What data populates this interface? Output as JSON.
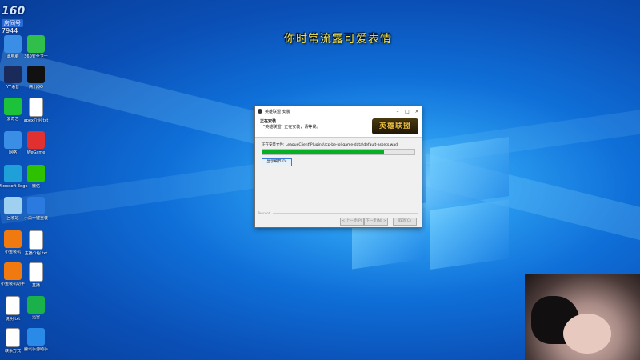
{
  "overlay": {
    "caption": "你时常流露可爱表情"
  },
  "watermark": {
    "logo": "160",
    "tag": "房间号",
    "room": "7944"
  },
  "desktop_icons": [
    {
      "label": "此电脑",
      "icon": "computer-icon",
      "color": "#3a8ee6"
    },
    {
      "label": "360安全卫士",
      "icon": "shield-icon",
      "color": "#2fbf4a"
    },
    {
      "label": "YY语音",
      "icon": "yy-icon",
      "color": "#1a2a5a"
    },
    {
      "label": "腾讯QQ",
      "icon": "qq-penguin-icon",
      "color": "#111111"
    },
    {
      "label": "爱奇艺",
      "icon": "iqiyi-icon",
      "color": "#1cc23a"
    },
    {
      "label": "apex介绍.txt",
      "icon": "file-icon",
      "color": "#ffffff"
    },
    {
      "label": "网络",
      "icon": "network-icon",
      "color": "#3a8ee6"
    },
    {
      "label": "WeGame",
      "icon": "wegame-icon",
      "color": "#e03030"
    },
    {
      "label": "Microsoft Edge",
      "icon": "edge-icon",
      "color": "#1fa0d8"
    },
    {
      "label": "微信",
      "icon": "wechat-icon",
      "color": "#2dc100"
    },
    {
      "label": "回收站",
      "icon": "recycle-bin-icon",
      "color": "#9fd0f0"
    },
    {
      "label": "小白一键重装",
      "icon": "reinstall-icon",
      "color": "#2a7ae0"
    },
    {
      "label": "小鱼装机",
      "icon": "fish-icon",
      "color": "#f07a10"
    },
    {
      "label": "主播介绍.txt",
      "icon": "file-icon",
      "color": "#ffffff"
    },
    {
      "label": "小鱼装机助手",
      "icon": "fish-icon",
      "color": "#f07a10"
    },
    {
      "label": "直播",
      "icon": "file-icon",
      "color": "#ffffff"
    },
    {
      "label": "说明.txt",
      "icon": "file-icon",
      "color": "#ffffff"
    },
    {
      "label": "迅雷",
      "icon": "thunder-icon",
      "color": "#1ab04a"
    },
    {
      "label": "联系方式",
      "icon": "file-icon",
      "color": "#ffffff"
    },
    {
      "label": "腾讯手游助手",
      "icon": "game-assistant-icon",
      "color": "#2a8ae8"
    }
  ],
  "installer": {
    "window_title": "英雄联盟 安装",
    "heading": "正在安装",
    "subheading": "\"英雄联盟\" 正在安装，请等候。",
    "logo_text": "英雄联盟",
    "status_text": "正在安装文件: LeagueClient\\Plugins\\rcp-be-lol-game-data\\default-assets.wad",
    "progress": 0.8,
    "details_button": "显示细节(D)",
    "brand": "Tencent",
    "back_button": "< 上一步(P)",
    "next_button": "下一步(N) >",
    "cancel_button": "取消(C)",
    "accent_color": "#06b025"
  }
}
